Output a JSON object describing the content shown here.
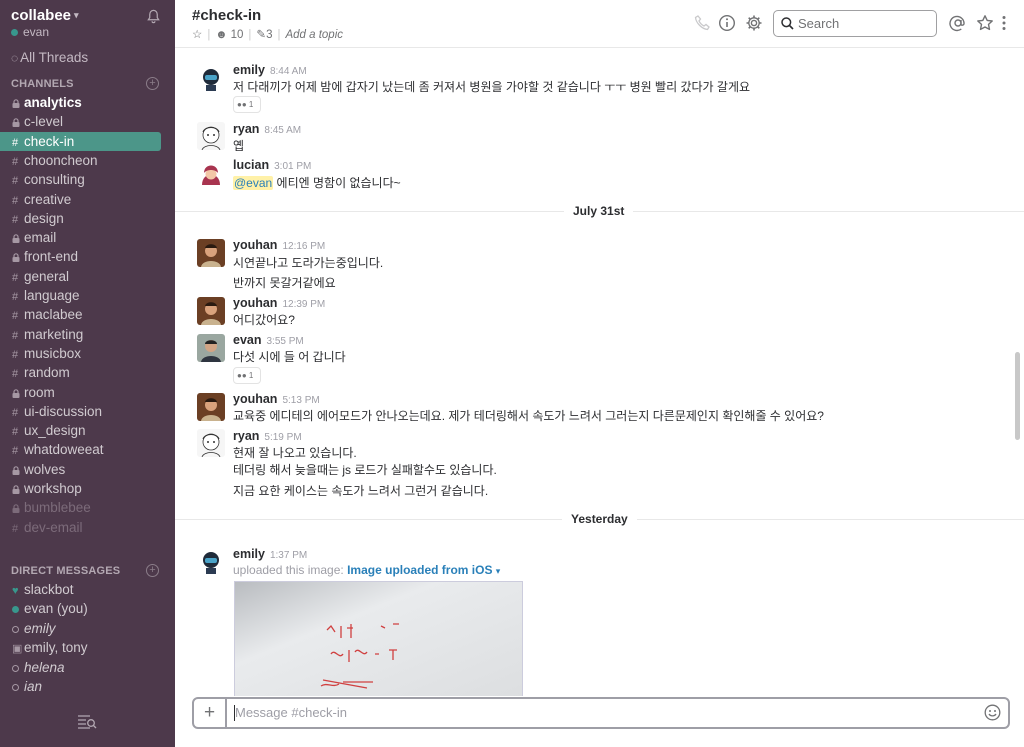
{
  "workspace": {
    "name": "collabee",
    "user": "evan"
  },
  "sidebar": {
    "all_threads": "All Threads",
    "channels_heading": "CHANNELS",
    "channels": [
      {
        "name": "analytics",
        "prefix": "lock",
        "style": "bold"
      },
      {
        "name": "c-level",
        "prefix": "lock",
        "style": "normal"
      },
      {
        "name": "check-in",
        "prefix": "#",
        "style": "active"
      },
      {
        "name": "chooncheon",
        "prefix": "#",
        "style": "normal"
      },
      {
        "name": "consulting",
        "prefix": "#",
        "style": "normal"
      },
      {
        "name": "creative",
        "prefix": "#",
        "style": "normal"
      },
      {
        "name": "design",
        "prefix": "#",
        "style": "normal"
      },
      {
        "name": "email",
        "prefix": "lock",
        "style": "normal"
      },
      {
        "name": "front-end",
        "prefix": "lock",
        "style": "normal"
      },
      {
        "name": "general",
        "prefix": "#",
        "style": "normal"
      },
      {
        "name": "language",
        "prefix": "#",
        "style": "normal"
      },
      {
        "name": "maclabee",
        "prefix": "#",
        "style": "normal"
      },
      {
        "name": "marketing",
        "prefix": "#",
        "style": "normal"
      },
      {
        "name": "musicbox",
        "prefix": "#",
        "style": "normal"
      },
      {
        "name": "random",
        "prefix": "#",
        "style": "normal"
      },
      {
        "name": "room",
        "prefix": "lock",
        "style": "normal"
      },
      {
        "name": "ui-discussion",
        "prefix": "#",
        "style": "normal"
      },
      {
        "name": "ux_design",
        "prefix": "#",
        "style": "normal"
      },
      {
        "name": "whatdoweeat",
        "prefix": "#",
        "style": "normal"
      },
      {
        "name": "wolves",
        "prefix": "lock",
        "style": "normal"
      },
      {
        "name": "workshop",
        "prefix": "lock",
        "style": "normal"
      },
      {
        "name": "bumblebee",
        "prefix": "lock",
        "style": "muted"
      },
      {
        "name": "dev-email",
        "prefix": "#",
        "style": "muted"
      }
    ],
    "dm_heading": "DIRECT MESSAGES",
    "dms": [
      {
        "name": "slackbot",
        "status": "heart"
      },
      {
        "name": "evan (you)",
        "status": "online"
      },
      {
        "name": "emily",
        "status": "away"
      },
      {
        "name": "emily, tony",
        "status": "group"
      },
      {
        "name": "helena",
        "status": "away"
      },
      {
        "name": "ian",
        "status": "away"
      }
    ]
  },
  "header": {
    "channel": "#check-in",
    "members": "10",
    "pins": "3",
    "topic_placeholder": "Add a topic",
    "search_placeholder": "Search"
  },
  "messages": {
    "m1": {
      "user": "emily",
      "time": "8:44 AM",
      "text": "저 다래끼가 어제 밤에 갑자기 났는데 좀 커져서 병원을 가야할 것 같습니다 ㅜㅜ 병원 빨리 갔다가 갈게요",
      "reaction": "1"
    },
    "m2": {
      "user": "ryan",
      "time": "8:45 AM",
      "text": "옙"
    },
    "m3": {
      "user": "lucian",
      "time": "3:01 PM",
      "mention": "@evan",
      "text": " 에티엔 명함이 없습니다~"
    },
    "divider1": "July 31st",
    "m4": {
      "user": "youhan",
      "time": "12:16 PM",
      "text1": "시연끝나고 도라가는중입니다.",
      "text2": "반까지 못갈거같에요"
    },
    "m5": {
      "user": "youhan",
      "time": "12:39 PM",
      "text": "어디갔어요?"
    },
    "m6": {
      "user": "evan",
      "time": "3:55 PM",
      "text": "다섯 시에 들 어 갑니다",
      "reaction": "1"
    },
    "m7": {
      "user": "youhan",
      "time": "5:13 PM",
      "text": "교육중 에디테의 에어모드가 안나오는데요. 제가 테더링해서 속도가 느려서 그러는지 다른문제인지 확인해줄 수 있어요?"
    },
    "m8": {
      "user": "ryan",
      "time": "5:19 PM",
      "text1": "현재 잘 나오고 있습니다.",
      "text2": "테더링 해서 늦을때는 js 로드가 실패할수도 있습니다.",
      "text3": "지금 요한 케이스는 속도가 느려서 그런거 같습니다."
    },
    "divider2": "Yesterday",
    "m9": {
      "user": "emily",
      "time": "1:37 PM",
      "upload_text": "uploaded this image:",
      "link": "Image uploaded from iOS"
    }
  },
  "composer": {
    "placeholder": "Message #check-in"
  },
  "colors": {
    "sidebar": "#4d394b",
    "active": "#4c9689",
    "link": "#2a80b9"
  }
}
